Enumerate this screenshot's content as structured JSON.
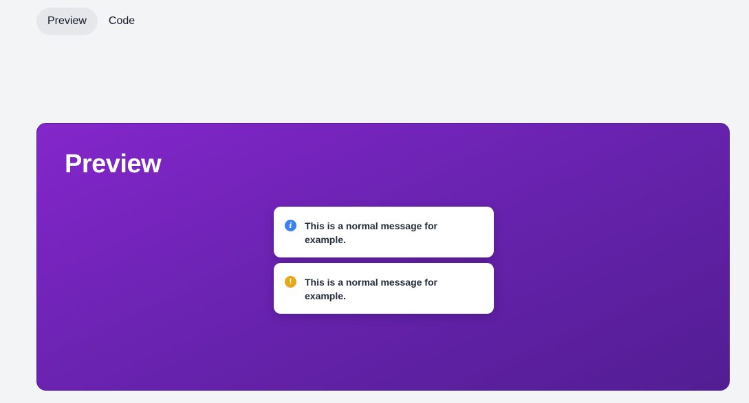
{
  "tabs": [
    {
      "label": "Preview",
      "active": true
    },
    {
      "label": "Code",
      "active": false
    }
  ],
  "preview": {
    "title": "Preview",
    "toasts": [
      {
        "icon": "info-icon",
        "icon_glyph": "i",
        "color": "#3b82f6",
        "message": "This is a normal message for example."
      },
      {
        "icon": "warning-icon",
        "icon_glyph": "!",
        "color": "#e5a91b",
        "message": "This is a normal message for example."
      }
    ]
  },
  "colors": {
    "page_background": "#f3f4f6",
    "panel_gradient_start": "#8426cc",
    "panel_gradient_end": "#521d93"
  }
}
